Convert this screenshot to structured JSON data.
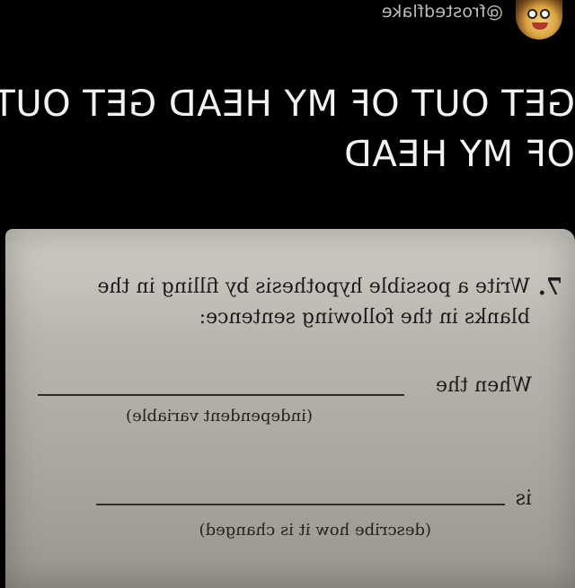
{
  "post": {
    "username": "@frostedflake",
    "avatar_icon": "cartoon-avatar-icon",
    "caption_line1": "GET OUT OF MY HEAD GET OUT",
    "caption_line2": "OF MY HEAD",
    "mirrored": true
  },
  "worksheet": {
    "question_number": "7.",
    "question_line1": "Write a possible hypothesis by filling in the",
    "question_line2": "blanks in the following sentence:",
    "blank1_prefix": "When the",
    "blank1_hint": "(independent variable)",
    "blank2_prefix": "is",
    "blank2_hint": "(describe how it is changed)"
  },
  "colors": {
    "background": "#000000",
    "caption": "#f2f2f2",
    "username": "#bdbdbd",
    "paper": "#bcb9b1",
    "ink": "#1b1b1b"
  }
}
